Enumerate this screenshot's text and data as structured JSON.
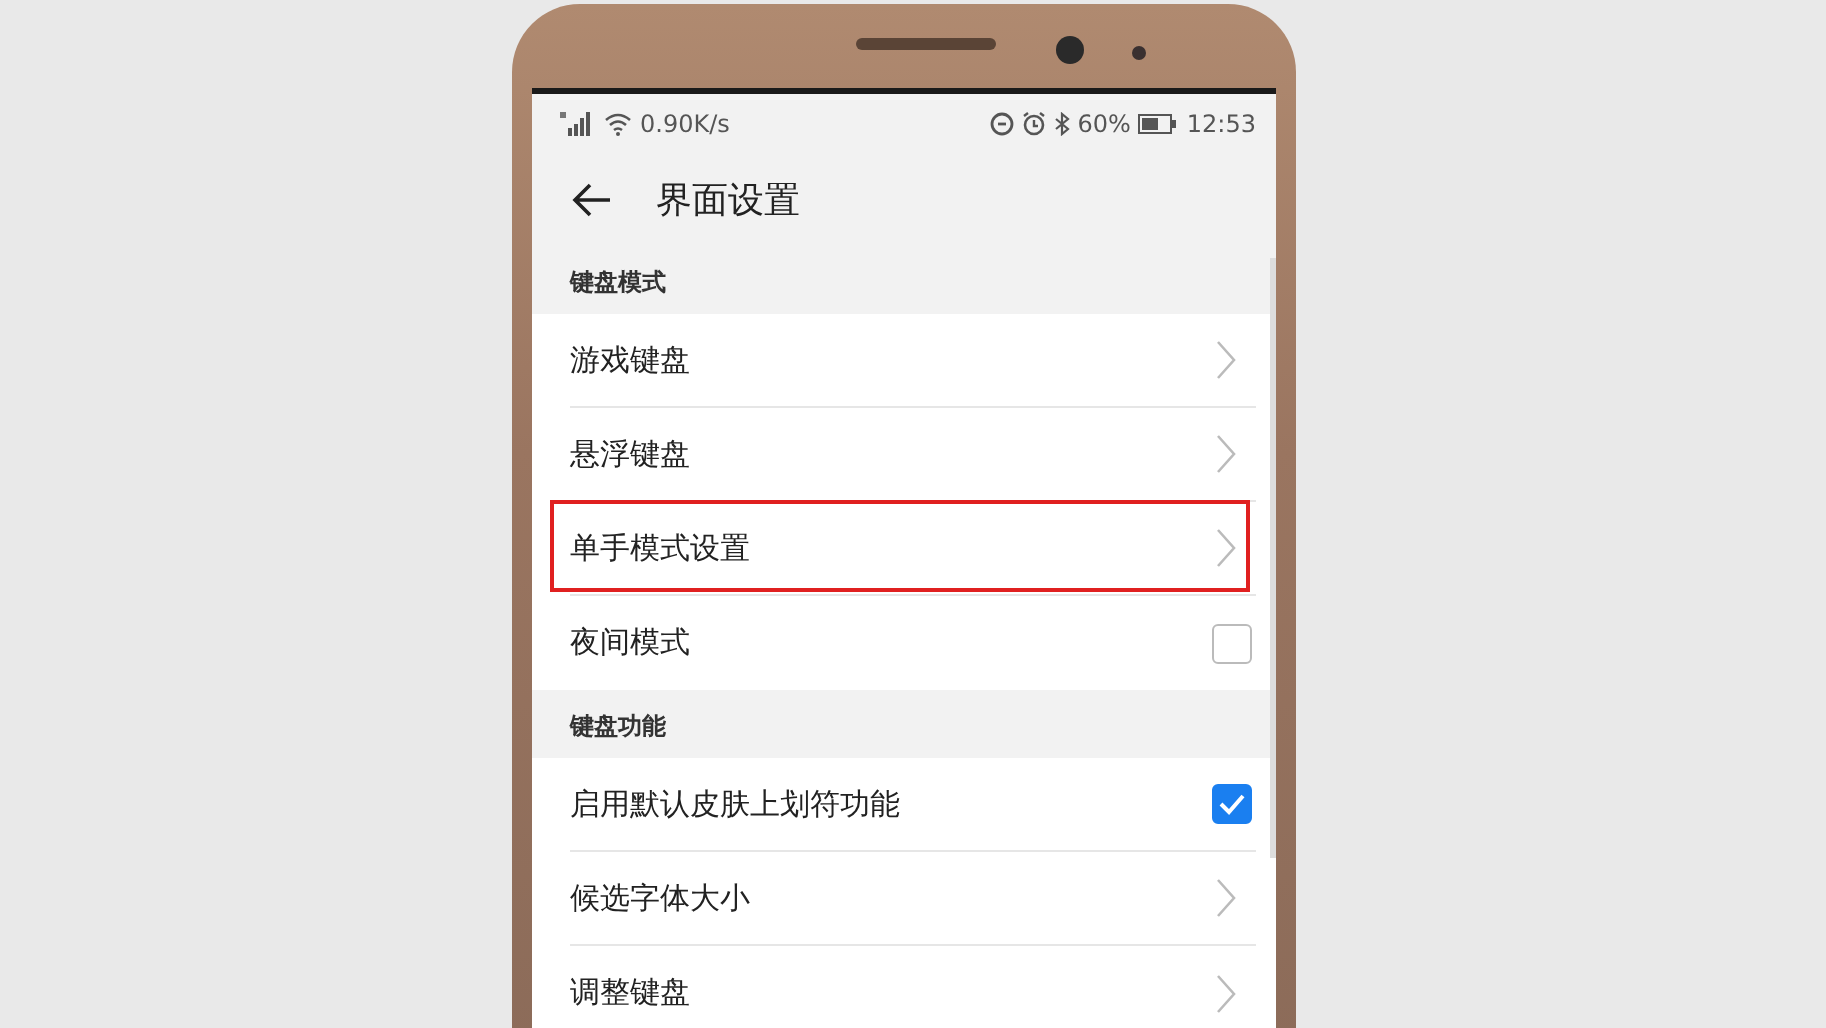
{
  "status_bar": {
    "network_speed": "0.90K/s",
    "battery": "60%",
    "time": "12:53"
  },
  "header": {
    "title": "界面设置"
  },
  "sections": [
    {
      "title": "键盘模式",
      "items": [
        {
          "kind": "link",
          "label": "游戏键盘"
        },
        {
          "kind": "link",
          "label": "悬浮键盘"
        },
        {
          "kind": "link",
          "label": "单手模式设置",
          "highlighted": true
        },
        {
          "kind": "checkbox",
          "label": "夜间模式",
          "checked": false
        }
      ]
    },
    {
      "title": "键盘功能",
      "items": [
        {
          "kind": "checkbox",
          "label": "启用默认皮肤上划符功能",
          "checked": true
        },
        {
          "kind": "link",
          "label": "候选字体大小"
        },
        {
          "kind": "link",
          "label": "调整键盘"
        }
      ]
    }
  ]
}
